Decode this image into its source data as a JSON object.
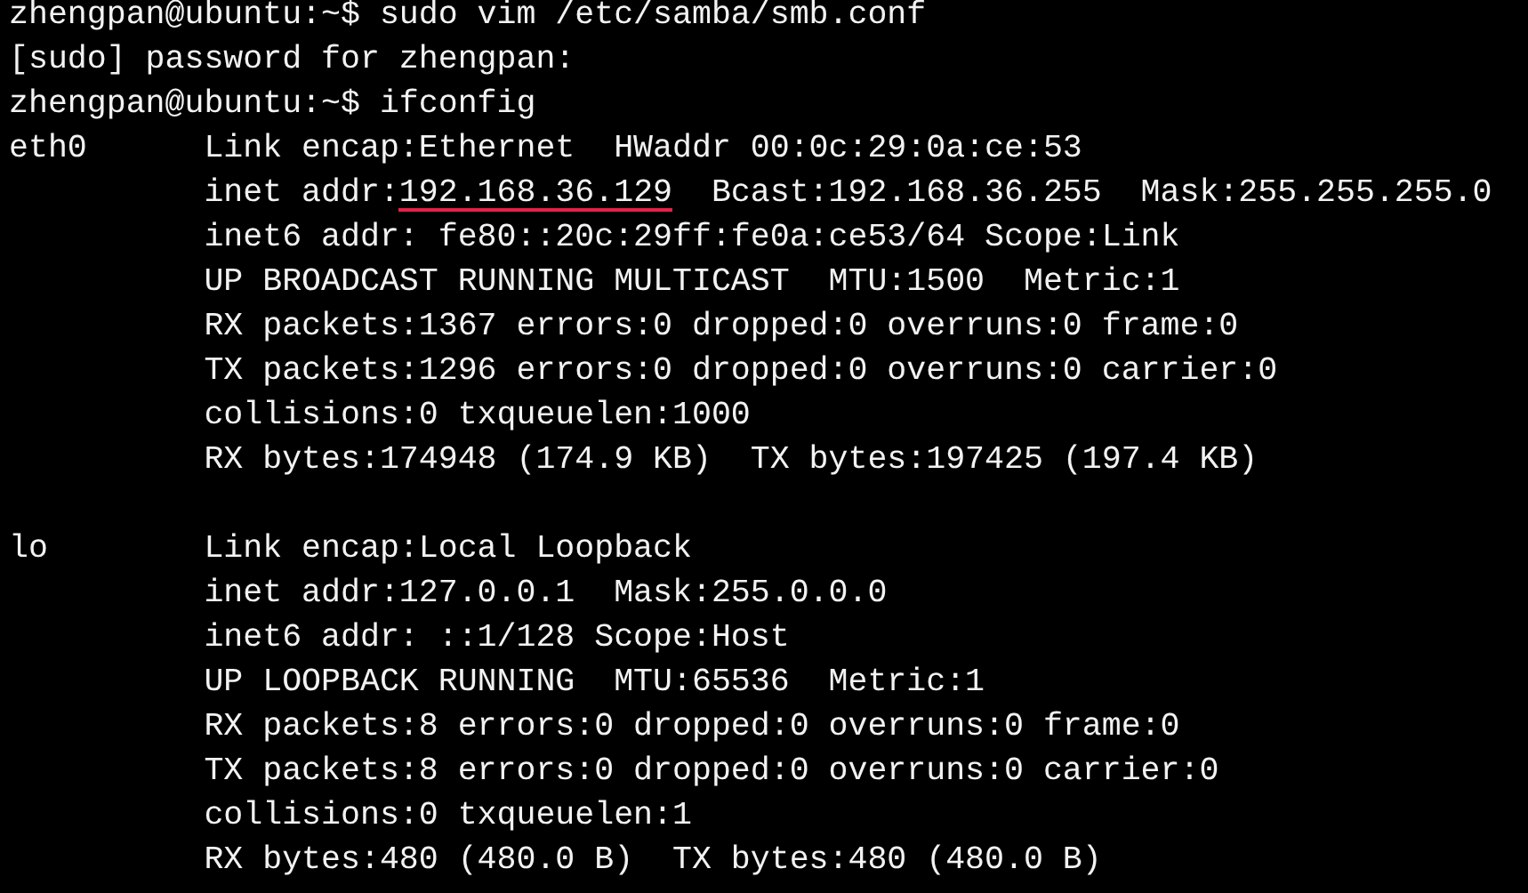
{
  "terminal": {
    "lines": [
      {
        "kind": "text",
        "segments": [
          {
            "text": "zhengpan@ubuntu:~$ sudo vim /etc/samba/smb.conf",
            "underlined": false
          }
        ]
      },
      {
        "kind": "text",
        "segments": [
          {
            "text": "[sudo] password for zhengpan:",
            "underlined": false
          }
        ]
      },
      {
        "kind": "text",
        "segments": [
          {
            "text": "zhengpan@ubuntu:~$ ifconfig",
            "underlined": false
          }
        ]
      },
      {
        "kind": "text",
        "segments": [
          {
            "text": "eth0      Link encap:Ethernet  HWaddr 00:0c:29:0a:ce:53",
            "underlined": false
          }
        ]
      },
      {
        "kind": "text",
        "segments": [
          {
            "text": "          inet addr:",
            "underlined": false
          },
          {
            "text": "192.168.36.129",
            "underlined": true
          },
          {
            "text": "  Bcast:192.168.36.255  Mask:255.255.255.0",
            "underlined": false
          }
        ]
      },
      {
        "kind": "text",
        "segments": [
          {
            "text": "          inet6 addr: fe80::20c:29ff:fe0a:ce53/64 Scope:Link",
            "underlined": false
          }
        ]
      },
      {
        "kind": "text",
        "segments": [
          {
            "text": "          UP BROADCAST RUNNING MULTICAST  MTU:1500  Metric:1",
            "underlined": false
          }
        ]
      },
      {
        "kind": "text",
        "segments": [
          {
            "text": "          RX packets:1367 errors:0 dropped:0 overruns:0 frame:0",
            "underlined": false
          }
        ]
      },
      {
        "kind": "text",
        "segments": [
          {
            "text": "          TX packets:1296 errors:0 dropped:0 overruns:0 carrier:0",
            "underlined": false
          }
        ]
      },
      {
        "kind": "text",
        "segments": [
          {
            "text": "          collisions:0 txqueuelen:1000",
            "underlined": false
          }
        ]
      },
      {
        "kind": "text",
        "segments": [
          {
            "text": "          RX bytes:174948 (174.9 KB)  TX bytes:197425 (197.4 KB)",
            "underlined": false
          }
        ]
      },
      {
        "kind": "blank"
      },
      {
        "kind": "text",
        "segments": [
          {
            "text": "lo        Link encap:Local Loopback",
            "underlined": false
          }
        ]
      },
      {
        "kind": "text",
        "segments": [
          {
            "text": "          inet addr:127.0.0.1  Mask:255.0.0.0",
            "underlined": false
          }
        ]
      },
      {
        "kind": "text",
        "segments": [
          {
            "text": "          inet6 addr: ::1/128 Scope:Host",
            "underlined": false
          }
        ]
      },
      {
        "kind": "text",
        "segments": [
          {
            "text": "          UP LOOPBACK RUNNING  MTU:65536  Metric:1",
            "underlined": false
          }
        ]
      },
      {
        "kind": "text",
        "segments": [
          {
            "text": "          RX packets:8 errors:0 dropped:0 overruns:0 frame:0",
            "underlined": false
          }
        ]
      },
      {
        "kind": "text",
        "segments": [
          {
            "text": "          TX packets:8 errors:0 dropped:0 overruns:0 carrier:0",
            "underlined": false
          }
        ]
      },
      {
        "kind": "text",
        "segments": [
          {
            "text": "          collisions:0 txqueuelen:1",
            "underlined": false
          }
        ]
      },
      {
        "kind": "text",
        "segments": [
          {
            "text": "          RX bytes:480 (480.0 B)  TX bytes:480 (480.0 B)",
            "underlined": false
          }
        ]
      }
    ]
  }
}
